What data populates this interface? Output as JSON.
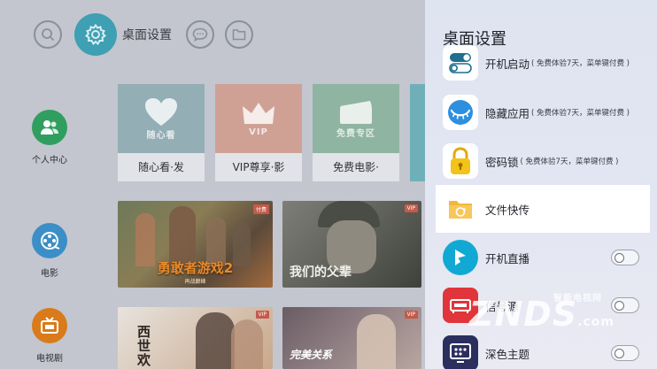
{
  "topbar": {
    "settings_label": "桌面设置"
  },
  "side_nav": [
    {
      "label": "个人中心",
      "icon": "user-group-icon",
      "color": "#2f9e5f"
    },
    {
      "label": "电影",
      "icon": "film-reel-icon",
      "color": "#3b8ec6"
    },
    {
      "label": "电视剧",
      "icon": "tv-icon",
      "color": "#d97b1a"
    }
  ],
  "tiles": [
    {
      "art_text": "随心看",
      "caption": "随心看·发",
      "color": "#93aeb5",
      "icon": "heart-icon"
    },
    {
      "art_text": "VIP",
      "caption": "VIP尊享·影",
      "color": "#cfa195",
      "icon": "crown-icon"
    },
    {
      "art_text": "免费专区",
      "caption": "免费电影·",
      "color": "#8fb4a2",
      "icon": "ticket-icon"
    }
  ],
  "posters": [
    {
      "title": "勇敢者游戏2",
      "subtitle": "再战巅峰",
      "badge": "付费"
    },
    {
      "title": "我们的父辈",
      "badge": "VIP"
    },
    {
      "title": "西世欢",
      "badge": "VIP"
    },
    {
      "title": "完美关系",
      "badge": "VIP"
    }
  ],
  "panel": {
    "title": "桌面设置",
    "items": [
      {
        "label": "开机启动",
        "note": "( 免费体验7天，菜单键付费 )",
        "icon": "boot-switch-icon",
        "color": "#1f6f8f"
      },
      {
        "label": "隐藏应用",
        "note": "( 免费体验7天，菜单键付费 )",
        "icon": "eye-closed-icon",
        "color": "#2d8fe0"
      },
      {
        "label": "密码锁",
        "note": "( 免费体验7天，菜单键付费 )",
        "icon": "padlock-icon",
        "color": "#f2c318"
      },
      {
        "label": "文件快传",
        "note": "",
        "icon": "folder-transfer-icon",
        "color": "#f3b73a"
      },
      {
        "label": "开机直播",
        "note": "",
        "icon": "live-play-icon",
        "color": "#11a9d4",
        "toggle": "off"
      },
      {
        "label": "信号源",
        "note": "",
        "icon": "signal-source-icon",
        "color": "#e0353a",
        "toggle": "off"
      },
      {
        "label": "深色主题",
        "note": "",
        "icon": "dark-theme-icon",
        "color": "#2b2f5e",
        "toggle": "off"
      }
    ]
  },
  "watermark": {
    "brand": "ZNDS",
    "suffix": ".com",
    "sub": "智能电视网"
  }
}
